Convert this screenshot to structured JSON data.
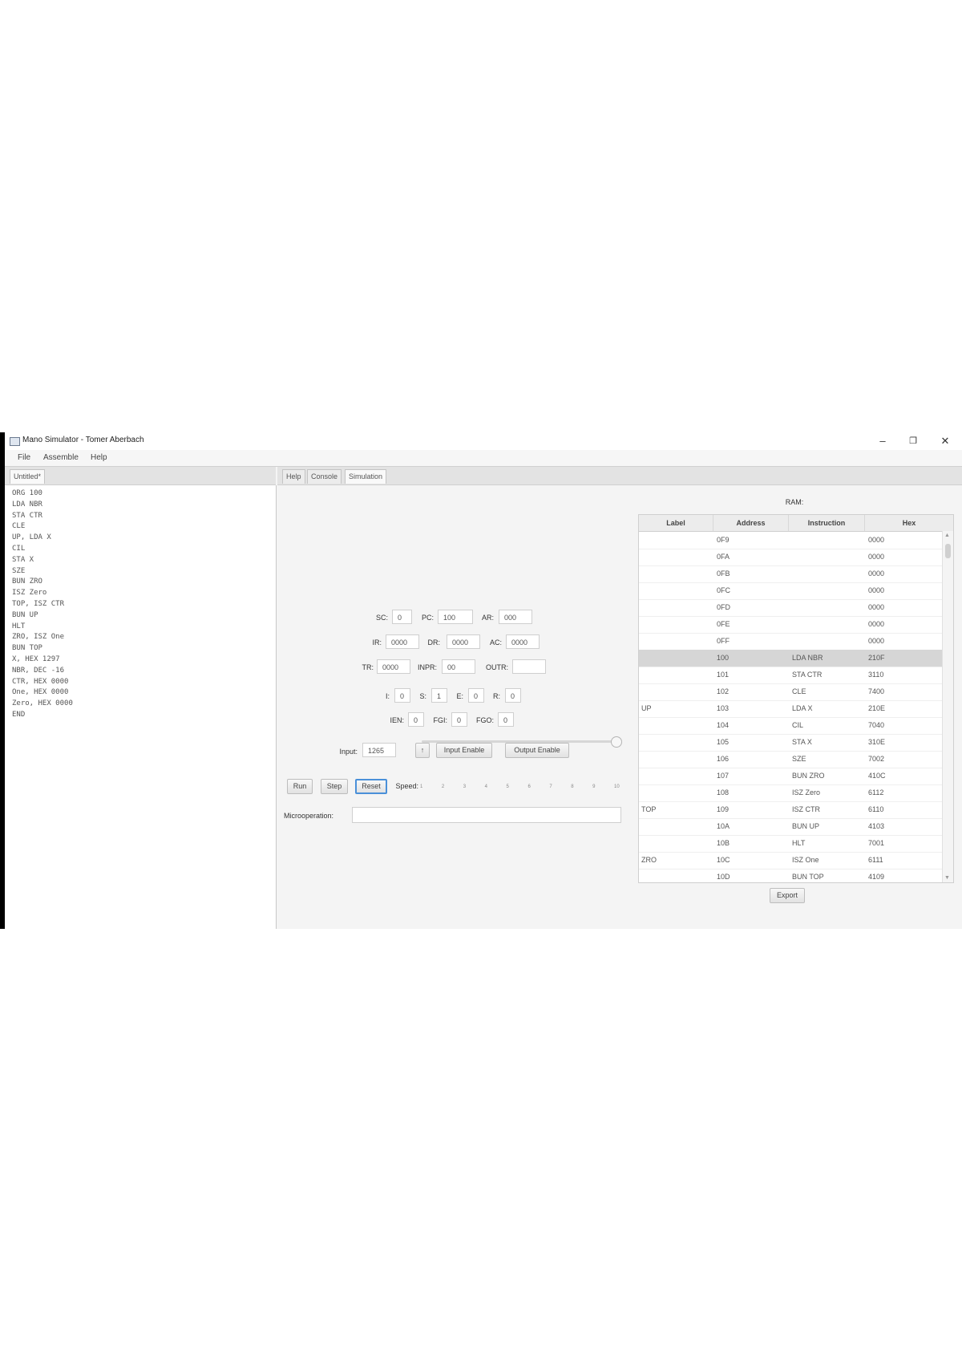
{
  "window": {
    "title": "Mano Simulator - Tomer Aberbach",
    "minimize": "–",
    "restore": "❐",
    "close": "✕"
  },
  "menu": [
    "File",
    "Assemble",
    "Help"
  ],
  "editor": {
    "tab": "Untitled*",
    "code": "ORG 100\nLDA NBR\nSTA CTR\nCLE\nUP, LDA X\nCIL\nSTA X\nSZE\nBUN ZRO\nISZ Zero\nTOP, ISZ CTR\nBUN UP\nHLT\nZRO, ISZ One\nBUN TOP\nX, HEX 1297\nNBR, DEC -16\nCTR, HEX 0000\nOne, HEX 0000\nZero, HEX 0000\nEND"
  },
  "tabs": [
    "Help",
    "Console",
    "Simulation"
  ],
  "registers": {
    "sc_label": "SC:",
    "sc": "0",
    "pc_label": "PC:",
    "pc": "100",
    "ar_label": "AR:",
    "ar": "000",
    "ir_label": "IR:",
    "ir": "0000",
    "dr_label": "DR:",
    "dr": "0000",
    "ac_label": "AC:",
    "ac": "0000",
    "tr_label": "TR:",
    "tr": "0000",
    "inpr_label": "INPR:",
    "inpr": "00",
    "outr_label": "OUTR:",
    "outr": "",
    "i_label": "I:",
    "i": "0",
    "s_label": "S:",
    "s": "1",
    "e_label": "E:",
    "e": "0",
    "r_label": "R:",
    "r": "0",
    "ien_label": "IEN:",
    "ien": "0",
    "fgi_label": "FGI:",
    "fgi": "0",
    "fgo_label": "FGO:",
    "fgo": "0"
  },
  "io": {
    "input_label": "Input:",
    "input": "1265",
    "submit": "↑",
    "input_enable": "Input Enable",
    "output_enable": "Output Enable"
  },
  "controls": {
    "run": "Run",
    "step": "Step",
    "reset": "Reset",
    "speed_label": "Speed:",
    "speed": 10,
    "ticks": [
      "1",
      "2",
      "3",
      "4",
      "5",
      "6",
      "7",
      "8",
      "9",
      "10"
    ]
  },
  "micro": {
    "label": "Microoperation:",
    "value": ""
  },
  "ram": {
    "title": "RAM:",
    "columns": [
      "Label",
      "Address",
      "Instruction",
      "Hex"
    ],
    "rows": [
      {
        "label": "",
        "address": "0F9",
        "instruction": "",
        "hex": "0000"
      },
      {
        "label": "",
        "address": "0FA",
        "instruction": "",
        "hex": "0000"
      },
      {
        "label": "",
        "address": "0FB",
        "instruction": "",
        "hex": "0000"
      },
      {
        "label": "",
        "address": "0FC",
        "instruction": "",
        "hex": "0000"
      },
      {
        "label": "",
        "address": "0FD",
        "instruction": "",
        "hex": "0000"
      },
      {
        "label": "",
        "address": "0FE",
        "instruction": "",
        "hex": "0000"
      },
      {
        "label": "",
        "address": "0FF",
        "instruction": "",
        "hex": "0000"
      },
      {
        "label": "",
        "address": "100",
        "instruction": "LDA NBR",
        "hex": "210F",
        "selected": true
      },
      {
        "label": "",
        "address": "101",
        "instruction": "STA CTR",
        "hex": "3110"
      },
      {
        "label": "",
        "address": "102",
        "instruction": "CLE",
        "hex": "7400"
      },
      {
        "label": "UP",
        "address": "103",
        "instruction": "LDA X",
        "hex": "210E"
      },
      {
        "label": "",
        "address": "104",
        "instruction": "CIL",
        "hex": "7040"
      },
      {
        "label": "",
        "address": "105",
        "instruction": "STA X",
        "hex": "310E"
      },
      {
        "label": "",
        "address": "106",
        "instruction": "SZE",
        "hex": "7002"
      },
      {
        "label": "",
        "address": "107",
        "instruction": "BUN ZRO",
        "hex": "410C"
      },
      {
        "label": "",
        "address": "108",
        "instruction": "ISZ Zero",
        "hex": "6112"
      },
      {
        "label": "TOP",
        "address": "109",
        "instruction": "ISZ CTR",
        "hex": "6110"
      },
      {
        "label": "",
        "address": "10A",
        "instruction": "BUN UP",
        "hex": "4103"
      },
      {
        "label": "",
        "address": "10B",
        "instruction": "HLT",
        "hex": "7001"
      },
      {
        "label": "ZRO",
        "address": "10C",
        "instruction": "ISZ One",
        "hex": "6111"
      },
      {
        "label": "",
        "address": "10D",
        "instruction": "BUN TOP",
        "hex": "4109"
      }
    ],
    "export": "Export"
  }
}
